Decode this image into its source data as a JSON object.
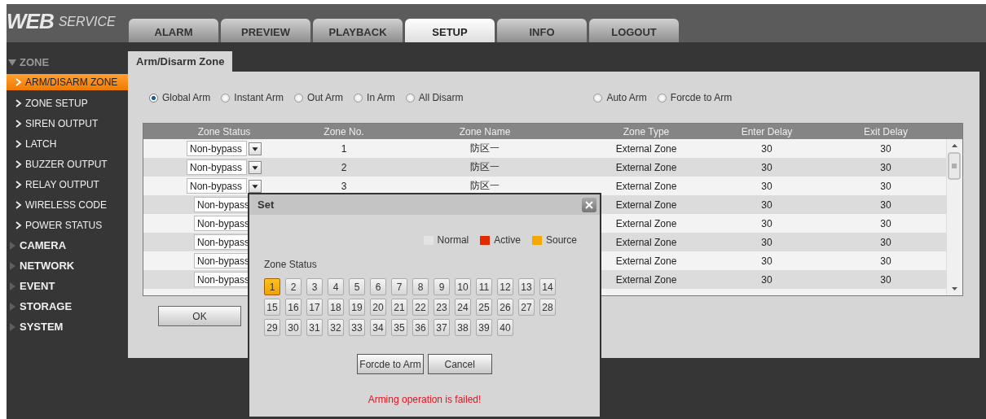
{
  "logo": {
    "main": "WEB",
    "sub": "SERVICE"
  },
  "tabs": [
    {
      "label": "ALARM",
      "selected": false
    },
    {
      "label": "PREVIEW",
      "selected": false
    },
    {
      "label": "PLAYBACK",
      "selected": false
    },
    {
      "label": "SETUP",
      "selected": true
    },
    {
      "label": "INFO",
      "selected": false
    },
    {
      "label": "LOGOUT",
      "selected": false
    }
  ],
  "sidebar": {
    "items": [
      {
        "label": "ZONE",
        "expanded": true,
        "children": [
          {
            "label": "ARM/DISARM ZONE",
            "selected": true
          },
          {
            "label": "ZONE SETUP",
            "selected": false
          },
          {
            "label": "SIREN OUTPUT",
            "selected": false
          },
          {
            "label": "LATCH",
            "selected": false
          },
          {
            "label": "BUZZER OUTPUT",
            "selected": false
          },
          {
            "label": "RELAY OUTPUT",
            "selected": false
          },
          {
            "label": "WIRELESS CODE",
            "selected": false
          },
          {
            "label": "POWER STATUS",
            "selected": false
          }
        ]
      },
      {
        "label": "CAMERA",
        "expanded": false
      },
      {
        "label": "NETWORK",
        "expanded": false
      },
      {
        "label": "EVENT",
        "expanded": false
      },
      {
        "label": "STORAGE",
        "expanded": false
      },
      {
        "label": "SYSTEM",
        "expanded": false
      }
    ]
  },
  "page_tab": "Arm/Disarm Zone",
  "arm_modes": [
    {
      "label": "Global Arm",
      "selected": true
    },
    {
      "label": "Instant Arm",
      "selected": false
    },
    {
      "label": "Out Arm",
      "selected": false
    },
    {
      "label": "In Arm",
      "selected": false
    },
    {
      "label": "All Disarm",
      "selected": false
    }
  ],
  "auto_modes": [
    {
      "label": "Auto Arm",
      "selected": false
    },
    {
      "label": "Forcde to Arm",
      "selected": false
    }
  ],
  "table": {
    "columns": [
      "Zone Status",
      "Zone No.",
      "Zone Name",
      "Zone Type",
      "Enter Delay",
      "Exit Delay"
    ],
    "rows": [
      {
        "status": "Non-bypass",
        "zone_no": "1",
        "zone_name": "防区一",
        "zone_type": "External Zone",
        "enter_delay": "30",
        "exit_delay": "30"
      },
      {
        "status": "Non-bypass",
        "zone_no": "2",
        "zone_name": "防区一",
        "zone_type": "External Zone",
        "enter_delay": "30",
        "exit_delay": "30"
      },
      {
        "status": "Non-bypass",
        "zone_no": "3",
        "zone_name": "防区一",
        "zone_type": "External Zone",
        "enter_delay": "30",
        "exit_delay": "30"
      },
      {
        "status": "Non-bypass",
        "zone_type": "External Zone",
        "enter_delay": "30",
        "exit_delay": "30"
      },
      {
        "status": "Non-bypass",
        "zone_type": "External Zone",
        "enter_delay": "30",
        "exit_delay": "30"
      },
      {
        "status": "Non-bypass",
        "zone_type": "External Zone",
        "enter_delay": "30",
        "exit_delay": "30"
      },
      {
        "status": "Non-bypass",
        "zone_type": "External Zone",
        "enter_delay": "30",
        "exit_delay": "30"
      },
      {
        "status": "Non-bypass",
        "zone_type": "External Zone",
        "enter_delay": "30",
        "exit_delay": "30"
      }
    ]
  },
  "ok_button": "OK",
  "modal": {
    "title": "Set",
    "legend": [
      {
        "label": "Normal",
        "color": "#e3e3e3"
      },
      {
        "label": "Active",
        "color": "#e22a00"
      },
      {
        "label": "Source",
        "color": "#f5a800"
      }
    ],
    "zone_status_label": "Zone Status",
    "zones": [
      {
        "label": "1",
        "kind": "source"
      },
      {
        "label": "2",
        "kind": "normal"
      },
      {
        "label": "3",
        "kind": "normal"
      },
      {
        "label": "4",
        "kind": "normal"
      },
      {
        "label": "5",
        "kind": "normal"
      },
      {
        "label": "6",
        "kind": "normal"
      },
      {
        "label": "7",
        "kind": "normal"
      },
      {
        "label": "8",
        "kind": "normal"
      },
      {
        "label": "9",
        "kind": "normal"
      },
      {
        "label": "10",
        "kind": "normal"
      },
      {
        "label": "11",
        "kind": "normal"
      },
      {
        "label": "12",
        "kind": "normal"
      },
      {
        "label": "13",
        "kind": "normal"
      },
      {
        "label": "14",
        "kind": "normal"
      },
      {
        "label": "15",
        "kind": "normal"
      },
      {
        "label": "16",
        "kind": "normal"
      },
      {
        "label": "17",
        "kind": "normal"
      },
      {
        "label": "18",
        "kind": "normal"
      },
      {
        "label": "19",
        "kind": "normal"
      },
      {
        "label": "20",
        "kind": "normal"
      },
      {
        "label": "21",
        "kind": "normal"
      },
      {
        "label": "22",
        "kind": "normal"
      },
      {
        "label": "23",
        "kind": "normal"
      },
      {
        "label": "24",
        "kind": "normal"
      },
      {
        "label": "25",
        "kind": "normal"
      },
      {
        "label": "26",
        "kind": "normal"
      },
      {
        "label": "27",
        "kind": "normal"
      },
      {
        "label": "28",
        "kind": "normal"
      },
      {
        "label": "29",
        "kind": "normal"
      },
      {
        "label": "30",
        "kind": "normal"
      },
      {
        "label": "31",
        "kind": "normal"
      },
      {
        "label": "32",
        "kind": "normal"
      },
      {
        "label": "33",
        "kind": "normal"
      },
      {
        "label": "34",
        "kind": "normal"
      },
      {
        "label": "35",
        "kind": "normal"
      },
      {
        "label": "36",
        "kind": "normal"
      },
      {
        "label": "37",
        "kind": "normal"
      },
      {
        "label": "38",
        "kind": "normal"
      },
      {
        "label": "39",
        "kind": "normal"
      },
      {
        "label": "40",
        "kind": "normal"
      }
    ],
    "buttons": [
      "Forcde to Arm",
      "Cancel"
    ],
    "error": "Arming operation is failed!"
  }
}
